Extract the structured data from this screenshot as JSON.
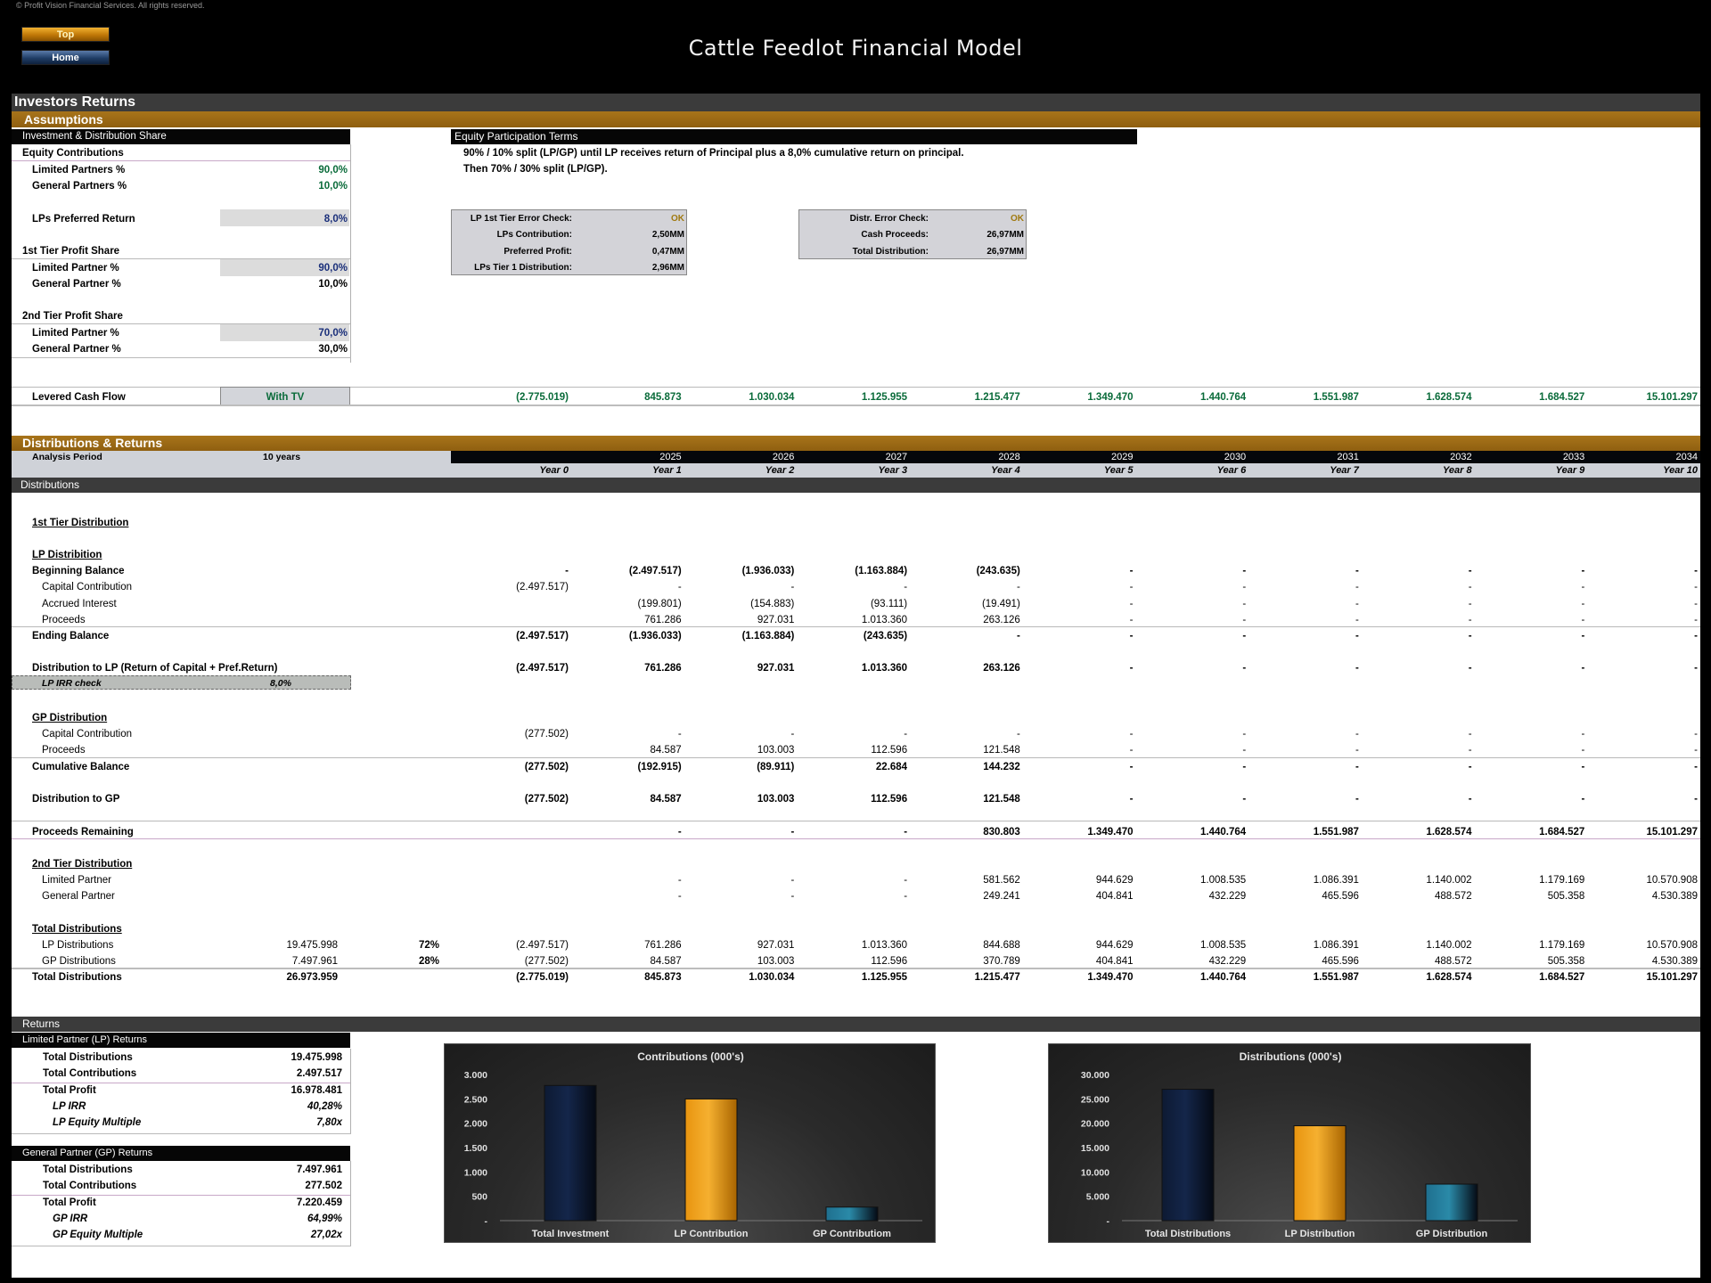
{
  "header": {
    "copyright": "© Profit Vision Financial Services. All rights reserved.",
    "title": "Cattle Feedlot Financial Model",
    "top_button": "Top",
    "home_button": "Home"
  },
  "page_title": "Investors Returns",
  "assumptions": {
    "section_title": "Assumptions",
    "inv_share_header": "Investment & Distribution Share",
    "equity_contributions": "Equity Contributions",
    "lp_pct_label": "Limited Partners %",
    "lp_pct": "90,0%",
    "gp_pct_label": "General Partners %",
    "gp_pct": "10,0%",
    "pref_return_label": "LPs Preferred Return",
    "pref_return": "8,0%",
    "tier1_title": "1st Tier Profit Share",
    "tier1_lp_label": "Limited Partner %",
    "tier1_lp": "90,0%",
    "tier1_gp_label": "General Partner %",
    "tier1_gp": "10,0%",
    "tier2_title": "2nd Tier Profit Share",
    "tier2_lp_label": "Limited Partner %",
    "tier2_lp": "70,0%",
    "tier2_gp_label": "General Partner %",
    "tier2_gp": "30,0%",
    "terms_header": "Equity Participation Terms",
    "terms_line1": "90% / 10% split (LP/GP) until LP receives return of Principal plus a 8,0% cumulative return on principal.",
    "terms_line2": "Then 70% / 30% split (LP/GP).",
    "check1": [
      {
        "label": "LP 1st Tier Error Check:",
        "value": "OK"
      },
      {
        "label": "LPs Contribution:",
        "value": "2,50MM"
      },
      {
        "label": "Preferred Profit:",
        "value": "0,47MM"
      },
      {
        "label": "LPs Tier 1 Distribution:",
        "value": "2,96MM"
      }
    ],
    "check2": [
      {
        "label": "Distr. Error Check:",
        "value": "OK"
      },
      {
        "label": "Cash Proceeds:",
        "value": "26,97MM"
      },
      {
        "label": "Total Distribution:",
        "value": "26,97MM"
      }
    ],
    "levered_label": "Levered Cash Flow",
    "levered_option": "With TV",
    "levered_values": [
      "(2.775.019)",
      "845.873",
      "1.030.034",
      "1.125.955",
      "1.215.477",
      "1.349.470",
      "1.440.764",
      "1.551.987",
      "1.628.574",
      "1.684.527",
      "15.101.297"
    ]
  },
  "distributions": {
    "section_title": "Distributions & Returns",
    "analysis_period_label": "Analysis Period",
    "analysis_period": "10 years",
    "years": [
      "",
      "2025",
      "2026",
      "2027",
      "2028",
      "2029",
      "2030",
      "2031",
      "2032",
      "2033",
      "2034"
    ],
    "year_labels": [
      "Year 0",
      "Year 1",
      "Year 2",
      "Year 3",
      "Year 4",
      "Year 5",
      "Year 6",
      "Year 7",
      "Year 8",
      "Year 9",
      "Year 10"
    ],
    "subheader": "Distributions",
    "tier1_title": "1st Tier Distribution",
    "lp_title": "LP Distribition",
    "lp_rows": [
      {
        "label": "Beginning Balance",
        "bold": true,
        "values": [
          "-",
          "(2.497.517)",
          "(1.936.033)",
          "(1.163.884)",
          "(243.635)",
          "-",
          "-",
          "-",
          "-",
          "-",
          "-"
        ]
      },
      {
        "label": "Capital Contribution",
        "bold": false,
        "values": [
          "(2.497.517)",
          "-",
          "-",
          "-",
          "-",
          "-",
          "-",
          "-",
          "-",
          "-",
          "-"
        ]
      },
      {
        "label": "Accrued Interest",
        "bold": false,
        "values": [
          "",
          "(199.801)",
          "(154.883)",
          "(93.111)",
          "(19.491)",
          "-",
          "-",
          "-",
          "-",
          "-",
          "-"
        ]
      },
      {
        "label": "Proceeds",
        "bold": false,
        "values": [
          "",
          "761.286",
          "927.031",
          "1.013.360",
          "263.126",
          "-",
          "-",
          "-",
          "-",
          "-",
          "-"
        ]
      },
      {
        "label": "Ending Balance",
        "bold": true,
        "values": [
          "(2.497.517)",
          "(1.936.033)",
          "(1.163.884)",
          "(243.635)",
          "-",
          "-",
          "-",
          "-",
          "-",
          "-",
          "-"
        ]
      }
    ],
    "lp_dist": {
      "label": "Distribution to LP (Return of Capital + Pref.Return)",
      "values": [
        "(2.497.517)",
        "761.286",
        "927.031",
        "1.013.360",
        "263.126",
        "-",
        "-",
        "-",
        "-",
        "-",
        "-"
      ]
    },
    "lp_irr_check_label": "LP IRR check",
    "lp_irr_check": "8,0%",
    "gp_title": "GP Distribution",
    "gp_rows": [
      {
        "label": "Capital Contribution",
        "bold": false,
        "values": [
          "(277.502)",
          "-",
          "-",
          "-",
          "-",
          "-",
          "-",
          "-",
          "-",
          "-",
          "-"
        ]
      },
      {
        "label": "Proceeds",
        "bold": false,
        "values": [
          "",
          "84.587",
          "103.003",
          "112.596",
          "121.548",
          "-",
          "-",
          "-",
          "-",
          "-",
          "-"
        ]
      },
      {
        "label": "Cumulative Balance",
        "bold": true,
        "values": [
          "(277.502)",
          "(192.915)",
          "(89.911)",
          "22.684",
          "144.232",
          "-",
          "-",
          "-",
          "-",
          "-",
          "-"
        ]
      }
    ],
    "gp_dist": {
      "label": "Distribution to GP",
      "values": [
        "(277.502)",
        "84.587",
        "103.003",
        "112.596",
        "121.548",
        "-",
        "-",
        "-",
        "-",
        "-",
        "-"
      ]
    },
    "proceeds_remaining": {
      "label": "Proceeds Remaining",
      "values": [
        "",
        "-",
        "-",
        "-",
        "830.803",
        "1.349.470",
        "1.440.764",
        "1.551.987",
        "1.628.574",
        "1.684.527",
        "15.101.297"
      ]
    },
    "tier2_title": "2nd Tier Distribution",
    "tier2_rows": [
      {
        "label": "Limited Partner",
        "values": [
          "",
          "-",
          "-",
          "-",
          "581.562",
          "944.629",
          "1.008.535",
          "1.086.391",
          "1.140.002",
          "1.179.169",
          "10.570.908"
        ]
      },
      {
        "label": "General Partner",
        "values": [
          "",
          "-",
          "-",
          "-",
          "249.241",
          "404.841",
          "432.229",
          "465.596",
          "488.572",
          "505.358",
          "4.530.389"
        ]
      }
    ],
    "total_title": "Total Distributions",
    "total_rows": [
      {
        "label": "LP Distributions",
        "total": "19.475.998",
        "pct": "72%",
        "bold": false,
        "values": [
          "(2.497.517)",
          "761.286",
          "927.031",
          "1.013.360",
          "844.688",
          "944.629",
          "1.008.535",
          "1.086.391",
          "1.140.002",
          "1.179.169",
          "10.570.908"
        ]
      },
      {
        "label": "GP Distributions",
        "total": "7.497.961",
        "pct": "28%",
        "bold": false,
        "values": [
          "(277.502)",
          "84.587",
          "103.003",
          "112.596",
          "370.789",
          "404.841",
          "432.229",
          "465.596",
          "488.572",
          "505.358",
          "4.530.389"
        ]
      },
      {
        "label": "Total Distributions",
        "total": "26.973.959",
        "pct": "",
        "bold": true,
        "values": [
          "(2.775.019)",
          "845.873",
          "1.030.034",
          "1.125.955",
          "1.215.477",
          "1.349.470",
          "1.440.764",
          "1.551.987",
          "1.628.574",
          "1.684.527",
          "15.101.297"
        ]
      }
    ]
  },
  "returns": {
    "section_title": "Returns",
    "lp_header": "Limited Partner (LP) Returns",
    "lp": [
      {
        "label": "Total Distributions",
        "value": "19.475.998",
        "style": "b"
      },
      {
        "label": "Total Contributions",
        "value": "2.497.517",
        "style": "b"
      },
      {
        "label": "Total Profit",
        "value": "16.978.481",
        "style": "b"
      },
      {
        "label": "LP IRR",
        "value": "40,28%",
        "style": "bi"
      },
      {
        "label": "LP Equity Multiple",
        "value": "7,80x",
        "style": "bi"
      }
    ],
    "gp_header": "General Partner (GP) Returns",
    "gp": [
      {
        "label": "Total Distributions",
        "value": "7.497.961",
        "style": "b"
      },
      {
        "label": "Total Contributions",
        "value": "277.502",
        "style": "b"
      },
      {
        "label": "Total Profit",
        "value": "7.220.459",
        "style": "b"
      },
      {
        "label": "GP IRR",
        "value": "64,99%",
        "style": "bi"
      },
      {
        "label": "GP Equity Multiple",
        "value": "27,02x",
        "style": "bi"
      }
    ]
  },
  "chart_data": [
    {
      "type": "bar",
      "title": "Contributions (000's)",
      "categories": [
        "Total Investment",
        "LP Contribution",
        "GP Contributiom"
      ],
      "values": [
        2775,
        2498,
        278
      ],
      "yticks": [
        "-",
        "500",
        "1.000",
        "1.500",
        "2.000",
        "2.500",
        "3.000"
      ],
      "ylim": [
        0,
        3000
      ],
      "colors": [
        "#0d1a33",
        "#e8940f",
        "#1f6f8f"
      ],
      "xlabel": "",
      "ylabel": "",
      "grid": false,
      "legend": "none"
    },
    {
      "type": "bar",
      "title": "Distributions (000's)",
      "categories": [
        "Total Distributions",
        "LP Distribution",
        "GP Distribution"
      ],
      "values": [
        26974,
        19476,
        7498
      ],
      "yticks": [
        "-",
        "5.000",
        "10.000",
        "15.000",
        "20.000",
        "25.000",
        "30.000"
      ],
      "ylim": [
        0,
        30000
      ],
      "colors": [
        "#0d1a33",
        "#e8940f",
        "#1f6f8f"
      ],
      "xlabel": "",
      "ylabel": "",
      "grid": false,
      "legend": "none"
    }
  ]
}
